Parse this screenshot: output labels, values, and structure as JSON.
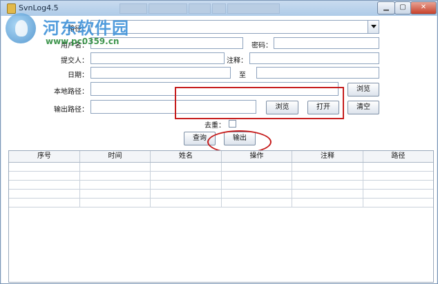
{
  "window": {
    "title": "SvnLog4.5",
    "controls": {
      "minimize": "▁",
      "maximize": "▢",
      "close": "✕"
    }
  },
  "watermark": {
    "title": "河东软件园",
    "url": "www.pc0359.cn"
  },
  "form": {
    "path_label": "路径：",
    "path_value": "",
    "username_label": "用户名：",
    "username_value": "",
    "password_label": "密码：",
    "password_value": "",
    "committer_label": "提交人：",
    "committer_value": "",
    "comment_label": "注释：",
    "comment_value": "",
    "date_label": "日期：",
    "date_from": "",
    "date_to_label": "至",
    "date_to": "",
    "local_path_label": "本地路径：",
    "local_path_value": "",
    "output_path_label": "输出路径：",
    "output_path_value": "",
    "browse_local_label": "浏览",
    "browse_output_label": "浏览",
    "open_label": "打开",
    "clear_label": "清空",
    "dedupe_label": "去重：",
    "dedupe_checked": false,
    "query_label": "查询",
    "export_label": "输出"
  },
  "table": {
    "columns": [
      "序号",
      "时间",
      "姓名",
      "操作",
      "注释",
      "路径"
    ],
    "rows": [
      [
        "",
        "",
        "",
        "",
        "",
        ""
      ],
      [
        "",
        "",
        "",
        "",
        "",
        ""
      ],
      [
        "",
        "",
        "",
        "",
        "",
        ""
      ],
      [
        "",
        "",
        "",
        "",
        "",
        ""
      ],
      [
        "",
        "",
        "",
        "",
        "",
        ""
      ]
    ]
  },
  "annotations": {
    "highlight_color": "#c61c1c"
  }
}
